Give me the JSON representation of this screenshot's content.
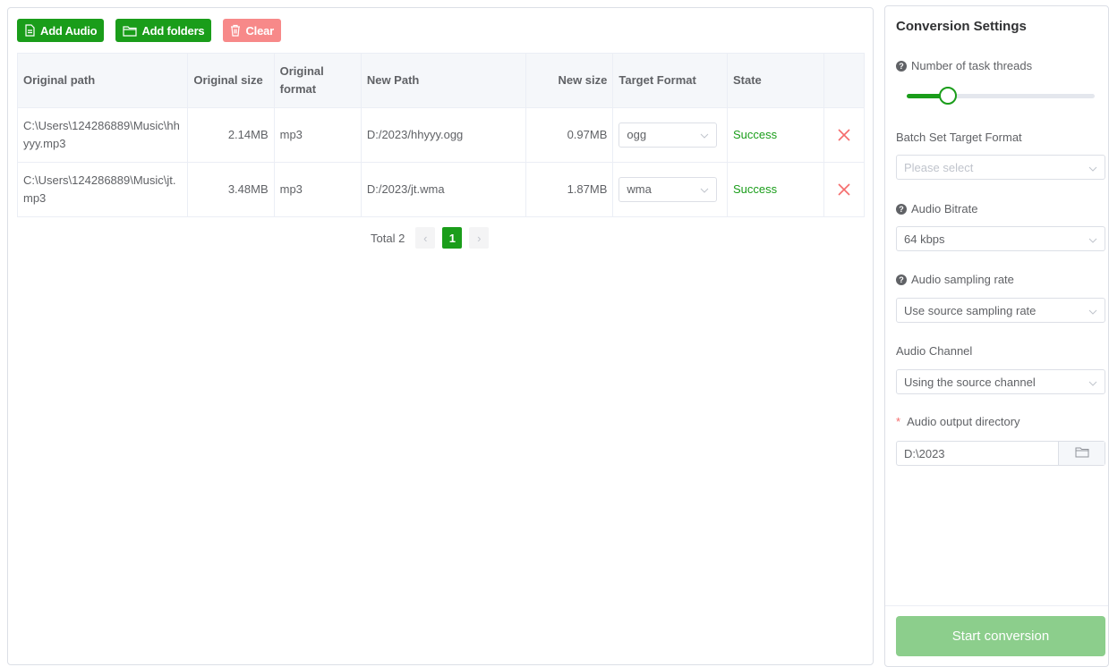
{
  "toolbar": {
    "add_audio": "Add Audio",
    "add_folders": "Add folders",
    "clear": "Clear"
  },
  "table": {
    "columns": [
      "Original path",
      "Original size",
      "Original format",
      "New Path",
      "New size",
      "Target Format",
      "State"
    ],
    "rows": [
      {
        "original_path": "C:\\Users\\124286889\\Music\\hhyyy.mp3",
        "original_size": "2.14MB",
        "original_format": "mp3",
        "new_path": "D:/2023/hhyyy.ogg",
        "new_size": "0.97MB",
        "target_format": "ogg",
        "state": "Success"
      },
      {
        "original_path": "C:\\Users\\124286889\\Music\\jt.mp3",
        "original_size": "3.48MB",
        "original_format": "mp3",
        "new_path": "D:/2023/jt.wma",
        "new_size": "1.87MB",
        "target_format": "wma",
        "state": "Success"
      }
    ]
  },
  "pagination": {
    "total": "Total 2",
    "current_page": "1"
  },
  "settings": {
    "title": "Conversion Settings",
    "threads_label": "Number of task threads",
    "threads_fraction": 0.22,
    "batch_format_label": "Batch Set Target Format",
    "batch_format_placeholder": "Please select",
    "bitrate_label": "Audio Bitrate",
    "bitrate_value": "64 kbps",
    "sampling_label": "Audio sampling rate",
    "sampling_value": "Use source sampling rate",
    "channel_label": "Audio Channel",
    "channel_value": "Using the source channel",
    "output_label": "Audio output directory",
    "output_value": "D:\\2023",
    "start_button": "Start conversion"
  },
  "colors": {
    "primary": "#1a9d1a",
    "danger": "#f78989",
    "disabled_primary": "#8cce8c"
  }
}
